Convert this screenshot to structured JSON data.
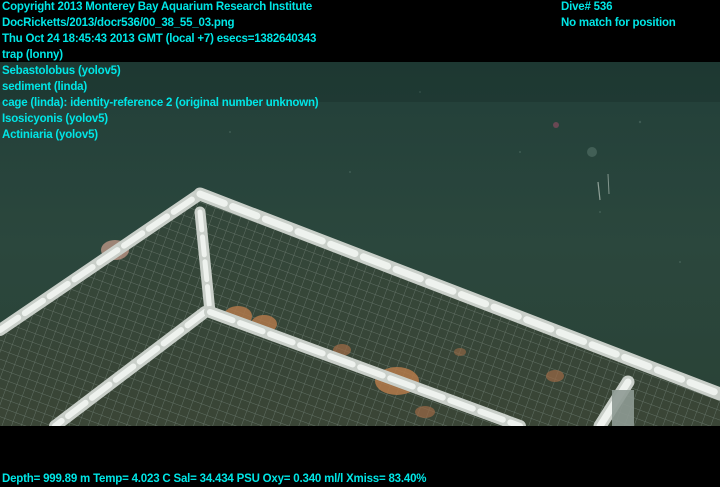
{
  "overlay": {
    "copyright": "Copyright 2013 Monterey Bay Aquarium Research Institute",
    "filename": "DocRicketts/2013/docr536/00_38_55_03.png",
    "timestamp": "Thu Oct 24 18:45:43 2013 GMT (local +7)  esecs=1382640343",
    "dive": "Dive# 536",
    "position_status": "No match for position",
    "annotations": [
      "trap (lonny)",
      "Sebastolobus (yolov5)",
      "sediment (linda)",
      "cage (linda): identity-reference 2 (original number unknown)",
      "Isosicyonis (yolov5)",
      "Actiniaria (yolov5)"
    ],
    "telemetry": "Depth= 999.89 m  Temp= 4.023 C  Sal= 34.434 PSU  Oxy= 0.340 ml/l  Xmiss= 83.40%"
  },
  "colors": {
    "overlay_text": "#00e6e6",
    "water": "#1f3e38",
    "sediment": "#2e4a40",
    "frame_white": "#e8ece8",
    "anemone": "#b0784a"
  }
}
